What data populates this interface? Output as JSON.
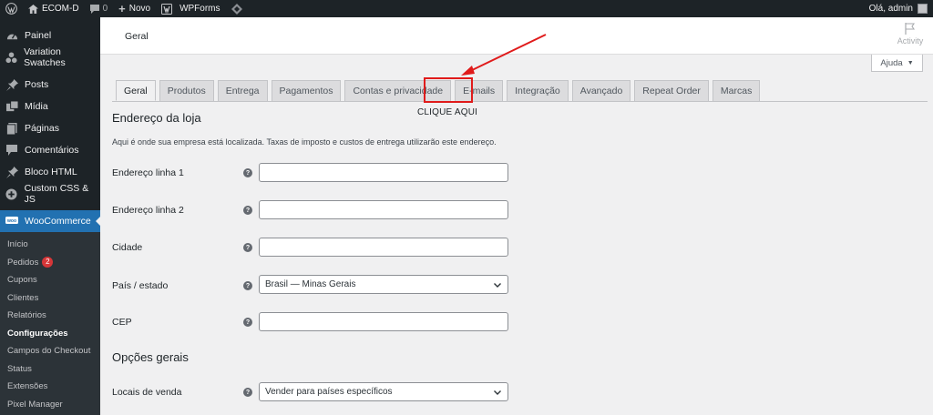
{
  "adminbar": {
    "site_name": "ECOM-D",
    "comments_count": "0",
    "new_label": "Novo",
    "wpforms_label": "WPForms",
    "greeting": "Olá, admin"
  },
  "sidebar": {
    "items": [
      {
        "label": "Painel",
        "icon": "dashboard-icon"
      },
      {
        "label": "Variation Swatches",
        "icon": "swatches-icon"
      },
      {
        "label": "Posts",
        "icon": "pin-icon"
      },
      {
        "label": "Mídia",
        "icon": "media-icon"
      },
      {
        "label": "Páginas",
        "icon": "pages-icon"
      },
      {
        "label": "Comentários",
        "icon": "comment-icon"
      },
      {
        "label": "Bloco HTML",
        "icon": "pin-icon"
      },
      {
        "label": "Custom CSS & JS",
        "icon": "plus-circle-icon"
      },
      {
        "label": "WooCommerce",
        "icon": "woo-icon"
      }
    ],
    "submenu": [
      {
        "label": "Início"
      },
      {
        "label": "Pedidos",
        "badge": "2"
      },
      {
        "label": "Cupons"
      },
      {
        "label": "Clientes"
      },
      {
        "label": "Relatórios"
      },
      {
        "label": "Configurações"
      },
      {
        "label": "Campos do Checkout"
      },
      {
        "label": "Status"
      },
      {
        "label": "Extensões"
      },
      {
        "label": "Pixel Manager"
      }
    ]
  },
  "header": {
    "title": "Geral",
    "activity_label": "Activity",
    "help_label": "Ajuda"
  },
  "tabs": [
    "Geral",
    "Produtos",
    "Entrega",
    "Pagamentos",
    "Contas e privacidade",
    "E-mails",
    "Integração",
    "Avançado",
    "Repeat Order",
    "Marcas"
  ],
  "annotation": {
    "text": "CLIQUE AQUI",
    "color": "#e01b1b"
  },
  "store_address": {
    "title": "Endereço da loja",
    "description": "Aqui é onde sua empresa está localizada. Taxas de imposto e custos de entrega utilizarão este endereço.",
    "fields": {
      "address1_label": "Endereço linha 1",
      "address1_value": "",
      "address2_label": "Endereço linha 2",
      "address2_value": "",
      "city_label": "Cidade",
      "city_value": "",
      "country_label": "País / estado",
      "country_value": "Brasil — Minas Gerais",
      "postcode_label": "CEP",
      "postcode_value": ""
    }
  },
  "general_options": {
    "title": "Opções gerais",
    "selling_label": "Locais de venda",
    "selling_value": "Vender para países específicos"
  },
  "colors": {
    "accent": "#2271b1",
    "admin_bg": "#1d2327",
    "badge": "#d63638"
  }
}
